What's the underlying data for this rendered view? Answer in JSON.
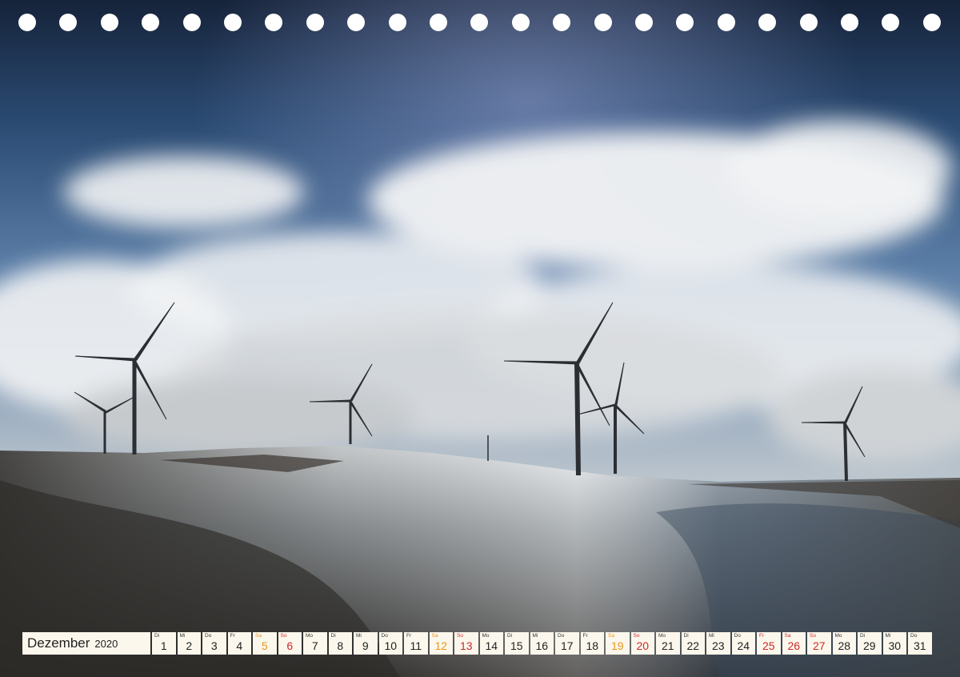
{
  "calendar": {
    "month": "Dezember",
    "year": "2020",
    "days": [
      {
        "wd": "Di",
        "n": "1",
        "t": "w"
      },
      {
        "wd": "Mi",
        "n": "2",
        "t": "w"
      },
      {
        "wd": "Do",
        "n": "3",
        "t": "w"
      },
      {
        "wd": "Fr",
        "n": "4",
        "t": "w"
      },
      {
        "wd": "Sa",
        "n": "5",
        "t": "sat"
      },
      {
        "wd": "So",
        "n": "6",
        "t": "sun"
      },
      {
        "wd": "Mo",
        "n": "7",
        "t": "w"
      },
      {
        "wd": "Di",
        "n": "8",
        "t": "w"
      },
      {
        "wd": "Mi",
        "n": "9",
        "t": "w"
      },
      {
        "wd": "Do",
        "n": "10",
        "t": "w"
      },
      {
        "wd": "Fr",
        "n": "11",
        "t": "w"
      },
      {
        "wd": "Sa",
        "n": "12",
        "t": "sat"
      },
      {
        "wd": "So",
        "n": "13",
        "t": "sun"
      },
      {
        "wd": "Mo",
        "n": "14",
        "t": "w"
      },
      {
        "wd": "Di",
        "n": "15",
        "t": "w"
      },
      {
        "wd": "Mi",
        "n": "16",
        "t": "w"
      },
      {
        "wd": "Do",
        "n": "17",
        "t": "w"
      },
      {
        "wd": "Fr",
        "n": "18",
        "t": "w"
      },
      {
        "wd": "Sa",
        "n": "19",
        "t": "sat"
      },
      {
        "wd": "So",
        "n": "20",
        "t": "sun"
      },
      {
        "wd": "Mo",
        "n": "21",
        "t": "w"
      },
      {
        "wd": "Di",
        "n": "22",
        "t": "w"
      },
      {
        "wd": "Mi",
        "n": "23",
        "t": "w"
      },
      {
        "wd": "Do",
        "n": "24",
        "t": "w"
      },
      {
        "wd": "Fr",
        "n": "25",
        "t": "hol"
      },
      {
        "wd": "Sa",
        "n": "26",
        "t": "hol"
      },
      {
        "wd": "So",
        "n": "27",
        "t": "sun"
      },
      {
        "wd": "Mo",
        "n": "28",
        "t": "w"
      },
      {
        "wd": "Di",
        "n": "29",
        "t": "w"
      },
      {
        "wd": "Mi",
        "n": "30",
        "t": "w"
      },
      {
        "wd": "Do",
        "n": "31",
        "t": "w"
      }
    ]
  },
  "colors": {
    "saturday": "#e7961e",
    "sunday_holiday": "#d0282a"
  }
}
